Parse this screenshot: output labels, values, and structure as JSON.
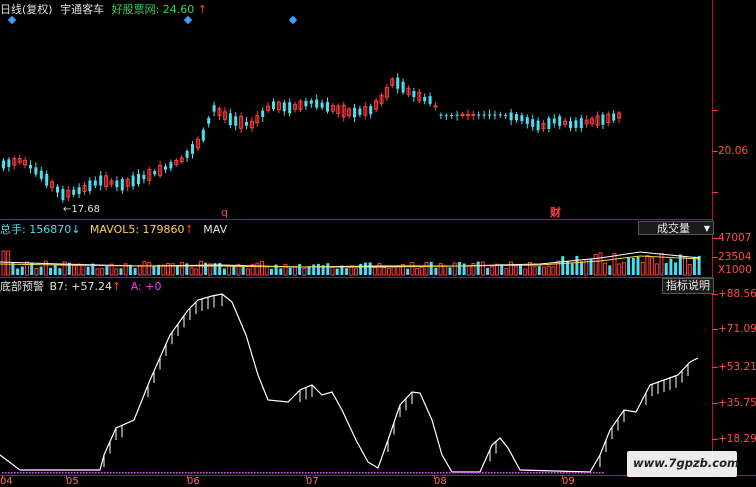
{
  "header": {
    "period_label": "日线(复权)",
    "stock_name": "宇通客车",
    "price_label": "好股票网: 24.60",
    "price_arrow": "↑"
  },
  "price_panel": {
    "low_marker": "17.68",
    "right_tick": "20.06",
    "event_q": "q",
    "event_cai": "财"
  },
  "volume_panel": {
    "total_label": "总手: 156870",
    "total_arrow": "↓",
    "mavol5_label": "MAVOL5: 179860",
    "mavol5_arrow": "↑",
    "mavol10_label": "MAV",
    "indicator_select": "成交量",
    "ticks": [
      "47007",
      "23504",
      "X1000"
    ]
  },
  "indicator_panel": {
    "title": "底部预警",
    "b7_label": "B7: +57.24",
    "b7_arrow": "↑",
    "a_label": "A: +0",
    "help_button": "指标说明",
    "ticks": [
      "+88.56",
      "+71.09",
      "+53.21",
      "+35.75",
      "+18.29"
    ]
  },
  "x_axis": {
    "labels": [
      "04",
      "05",
      "06",
      "07",
      "08",
      "09"
    ]
  },
  "watermark": "www.7gpzb.com",
  "colors": {
    "up": "#ff3b3b",
    "down": "#4cdff0",
    "price_label": "#35d25a",
    "grid": "#b21a1a",
    "dots": "#ff33ff",
    "ma5": "#ffffff",
    "ma10": "#ffd24a"
  }
}
